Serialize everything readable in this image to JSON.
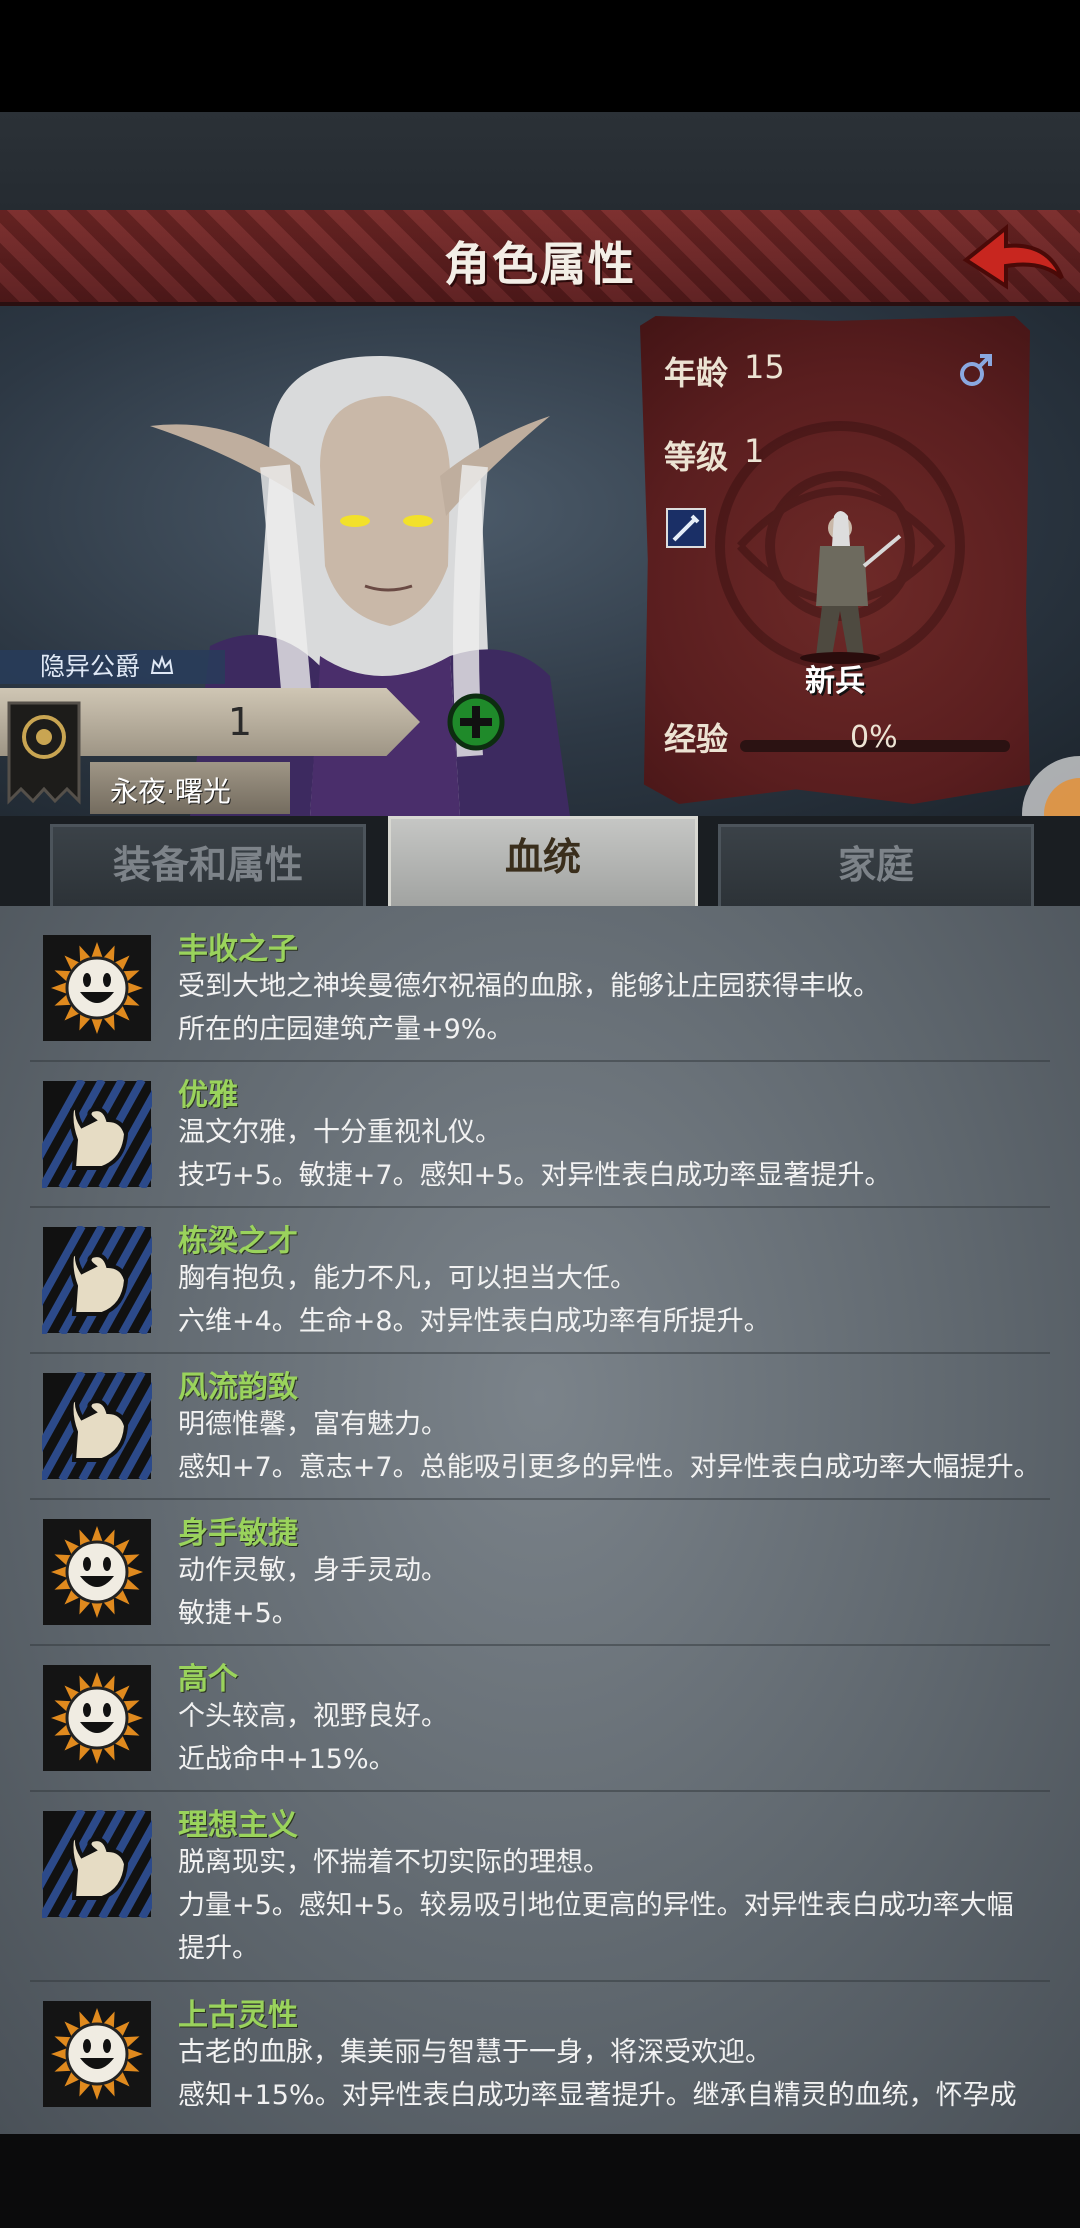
{
  "header": {
    "title": "角色属性",
    "back_icon": "back-arrow-icon"
  },
  "character": {
    "title": "隐异公爵",
    "banner_value": "1",
    "house_name": "永夜·曙光",
    "age_label": "年龄",
    "age": "15",
    "gender_icon": "male-icon",
    "level_label": "等级",
    "level": "1",
    "class_name": "新兵",
    "exp_label": "经验",
    "exp_percent": "0%",
    "exp_fraction": 0
  },
  "tabs": [
    {
      "label": "装备和属性",
      "active": false
    },
    {
      "label": "血统",
      "active": true
    },
    {
      "label": "家庭",
      "active": false
    }
  ],
  "traits": [
    {
      "icon": "sun-face-icon",
      "name": "丰收之子",
      "lines": [
        "受到大地之神埃曼德尔祝福的血脉，能够让庄园获得丰收。",
        "所在的庄园建筑产量+9%。"
      ]
    },
    {
      "icon": "arm-muscle-icon",
      "name": "优雅",
      "lines": [
        "温文尔雅，十分重视礼仪。",
        "技巧+5。敏捷+7。感知+5。对异性表白成功率显著提升。"
      ]
    },
    {
      "icon": "arm-muscle-icon",
      "name": "栋梁之才",
      "lines": [
        "胸有抱负，能力不凡，可以担当大任。",
        "六维+4。生命+8。对异性表白成功率有所提升。"
      ]
    },
    {
      "icon": "arm-muscle-icon",
      "name": "风流韵致",
      "lines": [
        "明德惟馨，富有魅力。",
        "感知+7。意志+7。总能吸引更多的异性。对异性表白成功率大幅提升。"
      ]
    },
    {
      "icon": "sun-face-icon",
      "name": "身手敏捷",
      "lines": [
        "动作灵敏，身手灵动。",
        "敏捷+5。"
      ]
    },
    {
      "icon": "sun-face-icon",
      "name": "高个",
      "lines": [
        "个头较高，视野良好。",
        "近战命中+15%。"
      ]
    },
    {
      "icon": "arm-muscle-icon",
      "name": "理想主义",
      "lines": [
        "脱离现实，怀揣着不切实际的理想。",
        "力量+5。感知+5。较易吸引地位更高的异性。对异性表白成功率大幅",
        "提升。"
      ]
    },
    {
      "icon": "sun-face-icon",
      "name": "上古灵性",
      "lines": [
        "古老的血脉，集美丽与智慧于一身，将深受欢迎。",
        "感知+15%。对异性表白成功率显著提升。继承自精灵的血统，怀孕成"
      ]
    }
  ]
}
